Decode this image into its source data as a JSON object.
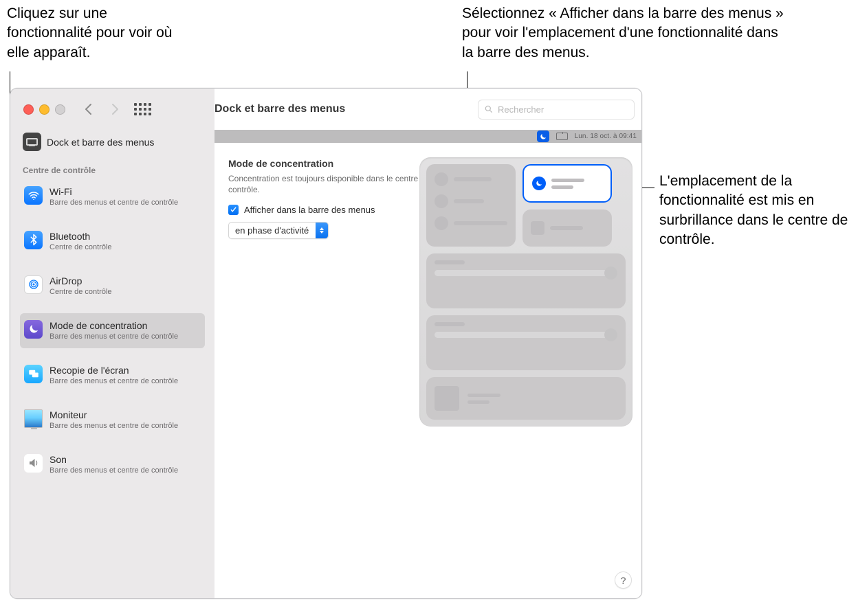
{
  "colors": {
    "accent": "#005ff9"
  },
  "callouts": {
    "topLeft": "Cliquez sur une fonctionnalité pour voir où elle apparaît.",
    "topRight": "Sélectionnez « Afficher dans la barre des menus » pour voir l'emplacement d'une fonctionnalité dans la barre des menus.",
    "right": "L'emplacement de la fonctionnalité est mis en surbrillance dans le centre de contrôle."
  },
  "window": {
    "title": "Dock et barre des menus",
    "searchPlaceholder": "Rechercher"
  },
  "sidebar": {
    "topItem": {
      "label": "Dock et barre des menus"
    },
    "section": "Centre de contrôle",
    "items": [
      {
        "name": "wifi",
        "title": "Wi-Fi",
        "sub": "Barre des menus et centre de contrôle",
        "selected": false
      },
      {
        "name": "bluetooth",
        "title": "Bluetooth",
        "sub": "Centre de contrôle",
        "selected": false
      },
      {
        "name": "airdrop",
        "title": "AirDrop",
        "sub": "Centre de contrôle",
        "selected": false
      },
      {
        "name": "focus",
        "title": "Mode de concentration",
        "sub": "Barre des menus et centre de contrôle",
        "selected": true
      },
      {
        "name": "screenmirror",
        "title": "Recopie de l'écran",
        "sub": "Barre des menus et centre de contrôle",
        "selected": false
      },
      {
        "name": "display",
        "title": "Moniteur",
        "sub": "Barre des menus et centre de contrôle",
        "selected": false
      },
      {
        "name": "sound",
        "title": "Son",
        "sub": "Barre des menus et centre de contrôle",
        "selected": false
      }
    ]
  },
  "detail": {
    "title": "Mode de concentration",
    "description": "Concentration est toujours disponible dans le centre de contrôle.",
    "checkbox": {
      "checked": true,
      "label": "Afficher dans la barre des menus"
    },
    "selectValue": "en phase d'activité"
  },
  "menubarPreview": {
    "datetime": "Lun. 18 oct. à 09:41",
    "icons": [
      "moon-icon",
      "cc-icon"
    ]
  },
  "helpTooltip": "?"
}
